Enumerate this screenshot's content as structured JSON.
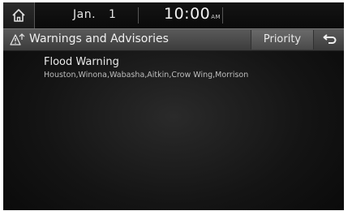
{
  "status_bar": {
    "month": "Jan.",
    "day": "1",
    "time": "10:00",
    "ampm": "AM"
  },
  "title_bar": {
    "title": "Warnings and Advisories",
    "priority_label": "Priority"
  },
  "alerts": [
    {
      "title": "Flood Warning",
      "areas": "Houston,Winona,Wabasha,Aitkin,Crow Wing,Morrison"
    }
  ],
  "icons": [
    "home-icon",
    "warning-icon",
    "back-icon"
  ]
}
